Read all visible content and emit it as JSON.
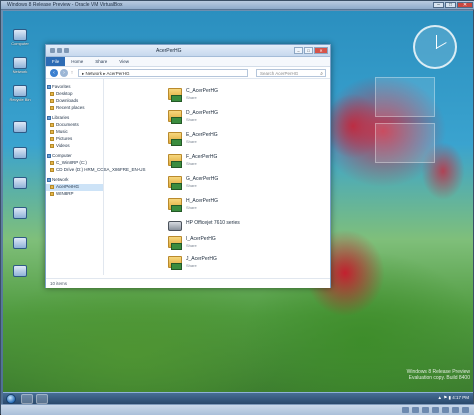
{
  "host": {
    "title": "Windows 8 Release Preview - Oracle VM VirtualBox",
    "minimize": "–",
    "maximize": "□",
    "close": "✕",
    "status": ""
  },
  "desktop_icons": [
    {
      "label": "Computer"
    },
    {
      "label": "Network"
    },
    {
      "label": "Recycle Bin"
    },
    {
      "label": ""
    },
    {
      "label": ""
    },
    {
      "label": ""
    },
    {
      "label": ""
    },
    {
      "label": ""
    },
    {
      "label": ""
    }
  ],
  "explorer": {
    "title": "AcerPerHG",
    "ribbon_tabs": [
      "File",
      "Home",
      "Share",
      "View"
    ],
    "address": "▸ Network ▸ AcerPerHG",
    "search_placeholder": "Search AcerPerHG",
    "nav": [
      {
        "label": "Favorites",
        "group": true
      },
      {
        "label": "Desktop"
      },
      {
        "label": "Downloads"
      },
      {
        "label": "Recent places"
      },
      {
        "label": "Libraries",
        "group": true
      },
      {
        "label": "Documents"
      },
      {
        "label": "Music"
      },
      {
        "label": "Pictures"
      },
      {
        "label": "Videos"
      },
      {
        "label": "Computer",
        "group": true
      },
      {
        "label": "C_Win8RP (C:)"
      },
      {
        "label": "CD Drive (D:) HRM_CCSA_X86FRE_EN-US"
      },
      {
        "label": "Network",
        "group": true
      },
      {
        "label": "AcerPerHG",
        "selected": true
      },
      {
        "label": "WIN8RP"
      }
    ],
    "items": [
      {
        "name": "C_AcerPerHG",
        "sub": "Share",
        "kind": "folder"
      },
      {
        "name": "D_AcerPerHG",
        "sub": "Share",
        "kind": "folder"
      },
      {
        "name": "E_AcerPerHG",
        "sub": "Share",
        "kind": "folder"
      },
      {
        "name": "F_AcerPerHG",
        "sub": "Share",
        "kind": "folder"
      },
      {
        "name": "G_AcerPerHG",
        "sub": "Share",
        "kind": "folder"
      },
      {
        "name": "H_AcerPerHG",
        "sub": "Share",
        "kind": "folder"
      },
      {
        "name": "HP Officejet 7610 series",
        "sub": "",
        "kind": "printer"
      },
      {
        "name": "I_AcerPerHG",
        "sub": "Share",
        "kind": "folder"
      },
      {
        "name": "J_AcerPerHG",
        "sub": "Share",
        "kind": "folder"
      }
    ],
    "status": "10 items"
  },
  "watermark": {
    "line1": "Windows 8 Release Preview",
    "line2": "Evaluation copy. Build 8400"
  },
  "taskbar": {
    "tray": "▲ ⚑ ▮ 4:17 PM"
  }
}
